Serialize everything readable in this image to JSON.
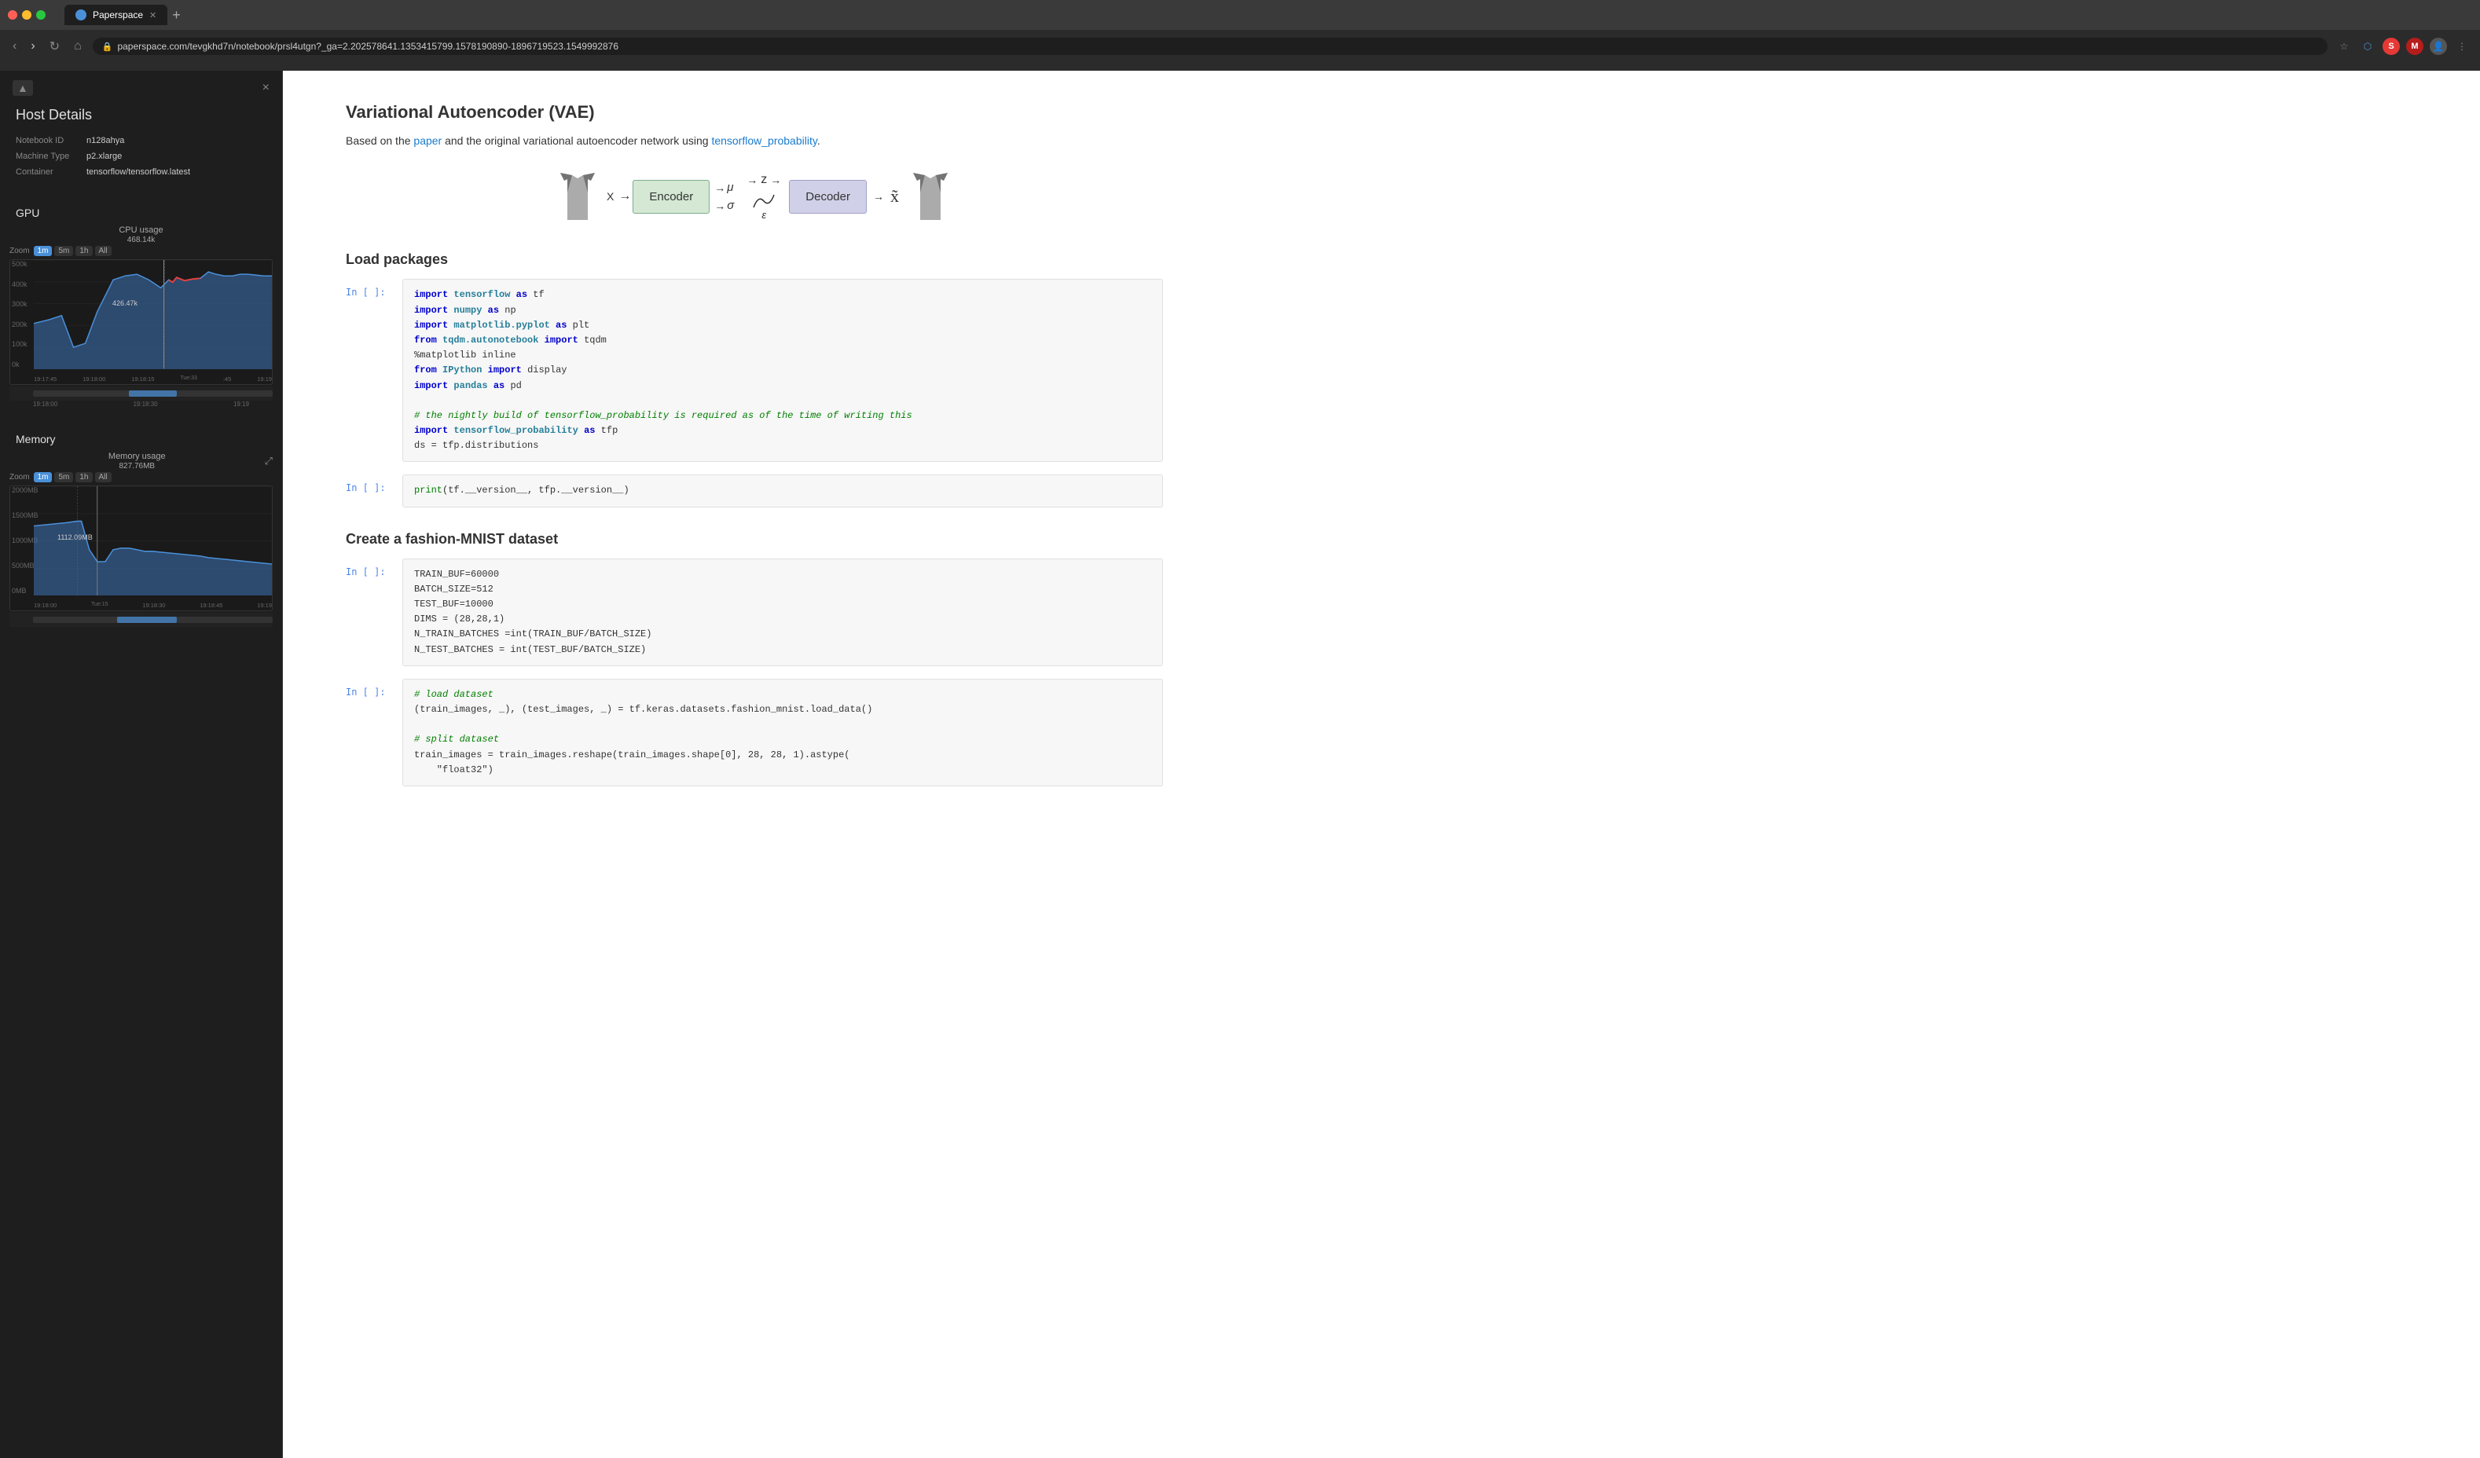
{
  "browser": {
    "tab_label": "Paperspace",
    "url": "paperspace.com/tevgkhd7n/notebook/prsl4utgn?_ga=2.202578641.1353415799.1578190890-1896719523.1549992876",
    "new_tab_label": "+"
  },
  "sidebar": {
    "title": "Host Details",
    "close_label": "×",
    "toggle_label": "▲",
    "details": {
      "notebook_id_label": "Notebook ID",
      "notebook_id_value": "n128ahya",
      "machine_type_label": "Machine Type",
      "machine_type_value": "p2.xlarge",
      "container_label": "Container",
      "container_value": "tensorflow/tensorflow.latest"
    },
    "gpu_section_title": "GPU",
    "cpu_chart": {
      "title": "CPU usage",
      "value": "468.14k",
      "zoom_label": "Zoom",
      "zoom_options": [
        "1m",
        "5m",
        "1h",
        "All"
      ],
      "zoom_active": "1m",
      "y_labels": [
        "500k",
        "400k",
        "300k",
        "200k",
        "100k",
        "0k"
      ],
      "x_labels": [
        "19:17:45",
        "19:18:00",
        "19:18:15",
        "Tuesday, Feb 19, 19:18:33",
        ":45",
        "19:19"
      ],
      "peak_value": "426.47k",
      "current_value": "468.14k"
    },
    "memory_section_title": "Memory",
    "memory_chart": {
      "title": "Memory usage",
      "value": "827.76MB",
      "zoom_label": "Zoom",
      "zoom_options": [
        "1m",
        "5m",
        "1h",
        "All"
      ],
      "zoom_active": "1m",
      "y_labels": [
        "2000MB",
        "1500MB",
        "1000MB",
        "500MB",
        "0MB"
      ],
      "x_labels": [
        "19:18:00",
        "Tuesday, Feb 19, 19:18:15",
        "19:18:30",
        "19:18:45",
        "19:19"
      ],
      "peak_value": "1112.09MB"
    }
  },
  "notebook": {
    "title": "Variational Autoencoder (VAE)",
    "description_prefix": "Based on the ",
    "paper_link": "paper",
    "description_middle": " and the original variational autoencoder network using ",
    "tf_link": "tensorflow_probability",
    "description_suffix": ".",
    "diagram": {
      "encoder_label": "Encoder",
      "decoder_label": "Decoder",
      "z_label": "z",
      "mu_label": "μ",
      "sigma_label": "σ",
      "epsilon_label": "ε",
      "tilde_x_label": "x̃"
    },
    "sections": [
      {
        "id": "load-packages",
        "title": "Load packages",
        "cells": [
          {
            "prompt": "In [ ]:",
            "code": [
              {
                "type": "keyword",
                "text": "import"
              },
              {
                "type": "plain",
                "text": " tensorflow "
              },
              {
                "type": "keyword",
                "text": "as"
              },
              {
                "type": "plain",
                "text": " tf"
              },
              {
                "type": "newline"
              },
              {
                "type": "keyword",
                "text": "import"
              },
              {
                "type": "plain",
                "text": " numpy "
              },
              {
                "type": "keyword",
                "text": "as"
              },
              {
                "type": "plain",
                "text": " np"
              },
              {
                "type": "newline"
              },
              {
                "type": "keyword",
                "text": "import"
              },
              {
                "type": "plain",
                "text": " matplotlib.pyplot "
              },
              {
                "type": "keyword",
                "text": "as"
              },
              {
                "type": "plain",
                "text": " plt"
              },
              {
                "type": "newline"
              },
              {
                "type": "keyword",
                "text": "from"
              },
              {
                "type": "plain",
                "text": " tqdm.autonotebook "
              },
              {
                "type": "keyword",
                "text": "import"
              },
              {
                "type": "plain",
                "text": " tqdm"
              },
              {
                "type": "newline"
              },
              {
                "type": "plain",
                "text": "%matplotlib inline"
              },
              {
                "type": "newline"
              },
              {
                "type": "keyword",
                "text": "from"
              },
              {
                "type": "plain",
                "text": " IPython "
              },
              {
                "type": "keyword",
                "text": "import"
              },
              {
                "type": "plain",
                "text": " display"
              },
              {
                "type": "newline"
              },
              {
                "type": "keyword",
                "text": "import"
              },
              {
                "type": "plain",
                "text": " pandas "
              },
              {
                "type": "keyword",
                "text": "as"
              },
              {
                "type": "plain",
                "text": " pd"
              },
              {
                "type": "newline"
              },
              {
                "type": "newline"
              },
              {
                "type": "comment",
                "text": "# the nightly build of tensorflow_probability is required as of the time of writing this"
              },
              {
                "type": "newline"
              },
              {
                "type": "keyword",
                "text": "import"
              },
              {
                "type": "plain",
                "text": " tensorflow_probability "
              },
              {
                "type": "keyword",
                "text": "as"
              },
              {
                "type": "plain",
                "text": " tfp"
              },
              {
                "type": "newline"
              },
              {
                "type": "plain",
                "text": "ds = tfp.distributions"
              }
            ],
            "code_text": "import tensorflow as tf\nimport numpy as np\nimport matplotlib.pyplot as plt\nfrom tqdm.autonotebook import tqdm\n%matplotlib inline\nfrom IPython import display\nimport pandas as pd\n\n# the nightly build of tensorflow_probability is required as of the time of writing this\nimport tensorflow_probability as tfp\nds = tfp.distributions"
          },
          {
            "prompt": "In [ ]:",
            "code_text": "print(tf.__version__, tfp.__version__)"
          }
        ]
      },
      {
        "id": "create-dataset",
        "title": "Create a fashion-MNIST dataset",
        "cells": [
          {
            "prompt": "In [ ]:",
            "code_text": "TRAIN_BUF=60000\nBATCH_SIZE=512\nTEST_BUF=10000\nDIMS = (28,28,1)\nN_TRAIN_BATCHES =int(TRAIN_BUF/BATCH_SIZE)\nN_TEST_BATCHES = int(TEST_BUF/BATCH_SIZE)"
          },
          {
            "prompt": "In [ ]:",
            "code_text": "# load dataset\n(train_images, _), (test_images, _) = tf.keras.datasets.fashion_mnist.load_data()\n\n# split dataset\ntrain_images = train_images.reshape(train_images.shape[0], 28, 28, 1).astype(\n    \"float32\")"
          }
        ]
      }
    ]
  }
}
